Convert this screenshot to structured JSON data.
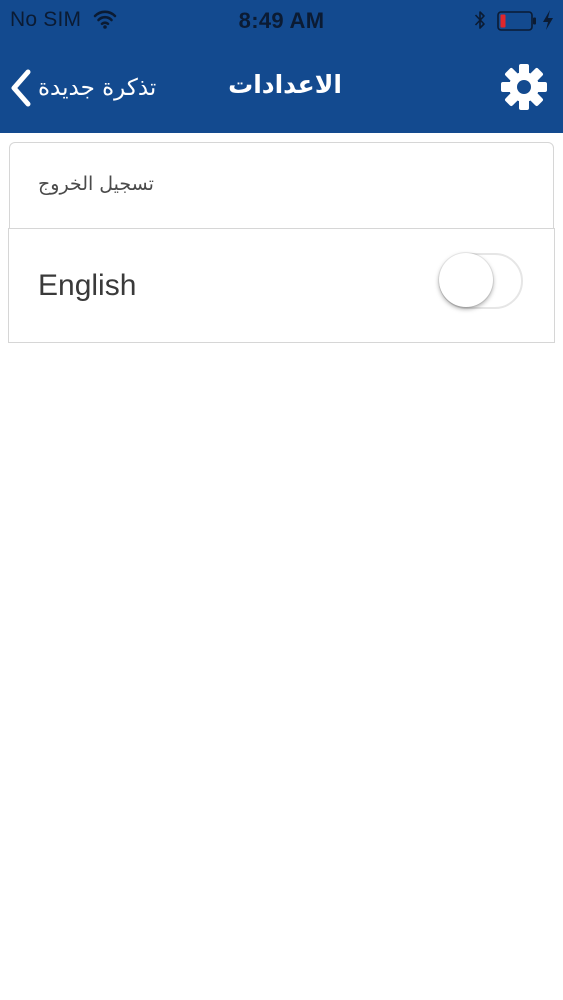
{
  "status_bar": {
    "carrier": "No SIM",
    "time": "8:49 AM",
    "icons": [
      "wifi-icon",
      "bluetooth-icon",
      "battery-icon",
      "charging-icon"
    ],
    "battery_color": "#e0262b"
  },
  "nav": {
    "back_label": "تذكرة جديدة",
    "title": "الاعدادات",
    "back_icon": "chevron-left-icon",
    "settings_icon": "gear-icon",
    "background_color": "#134a8f"
  },
  "settings": {
    "logout_label": "تسجيل الخروج",
    "english_label": "English",
    "english_toggle_on": false
  }
}
